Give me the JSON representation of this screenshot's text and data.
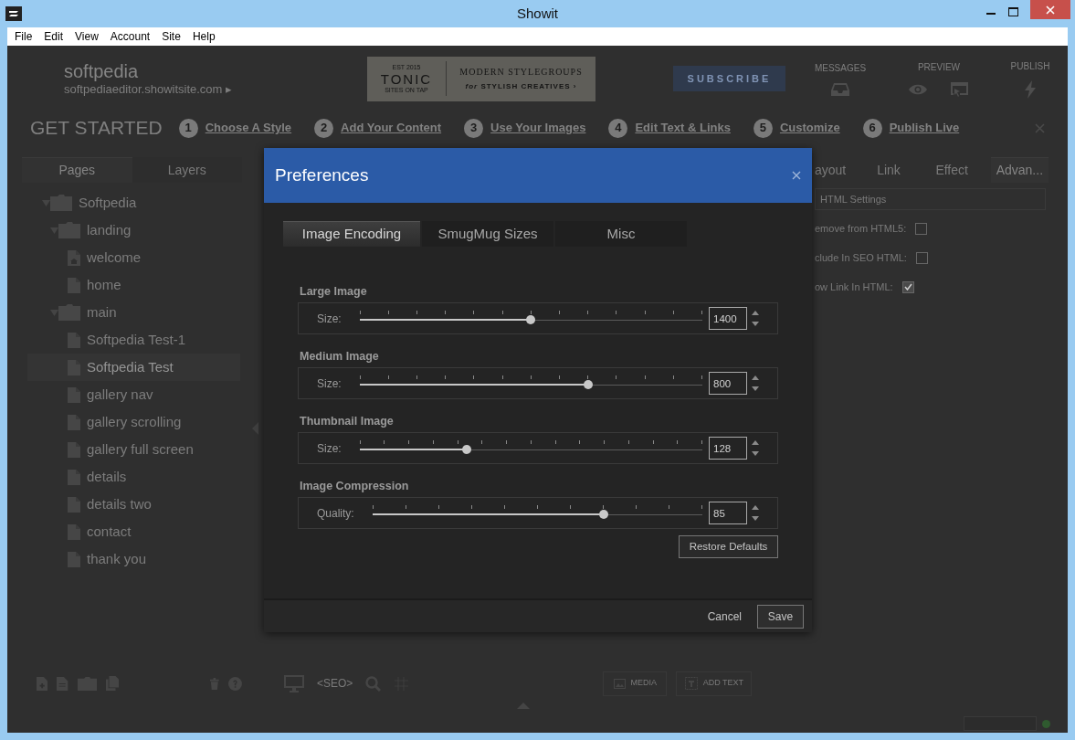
{
  "window": {
    "title": "Showit"
  },
  "menu": [
    {
      "label": "File"
    },
    {
      "label": "Edit"
    },
    {
      "label": "View"
    },
    {
      "label": "Account"
    },
    {
      "label": "Site"
    },
    {
      "label": "Help"
    }
  ],
  "header": {
    "site_name": "softpedia",
    "site_url": "softpediaeditor.showitsite.com ▸",
    "ad": {
      "badge_top": "EST 2015",
      "brand": "TONIC",
      "badge_bottom": "SITES ON TAP",
      "line1": "MODERN STYLEGROUPS",
      "line2": "*for* STYLISH CREATIVES ›"
    },
    "subscribe": "SUBSCRIBE",
    "actions": [
      {
        "label": "MESSAGES",
        "kind": "messages"
      },
      {
        "label": "PREVIEW",
        "kind": "preview"
      },
      {
        "label": "PUBLISH",
        "kind": "publish"
      }
    ]
  },
  "get_started": {
    "title": "GET STARTED",
    "steps": [
      {
        "number": "1",
        "label": "Choose A Style"
      },
      {
        "number": "2",
        "label": "Add Your Content"
      },
      {
        "number": "3",
        "label": "Use Your Images"
      },
      {
        "number": "4",
        "label": "Edit Text & Links"
      },
      {
        "number": "5",
        "label": "Customize"
      },
      {
        "number": "6",
        "label": "Publish Live"
      }
    ]
  },
  "left_panel": {
    "tabs": [
      {
        "label": "Pages",
        "selected": true
      },
      {
        "label": "Layers",
        "selected": false
      }
    ],
    "tree": [
      {
        "label": "Softpedia",
        "kind": "folder",
        "expanded": true,
        "selected": false,
        "children": [
          {
            "label": "landing",
            "kind": "folder",
            "expanded": true,
            "selected": false,
            "children": [
              {
                "label": "welcome",
                "kind": "home",
                "selected": false
              },
              {
                "label": "home",
                "kind": "page",
                "selected": false
              }
            ]
          },
          {
            "label": "main",
            "kind": "folder",
            "expanded": true,
            "selected": false,
            "children": [
              {
                "label": "Softpedia Test-1",
                "kind": "page",
                "selected": false
              },
              {
                "label": "Softpedia Test",
                "kind": "page",
                "selected": true
              },
              {
                "label": "gallery nav",
                "kind": "page",
                "selected": false
              },
              {
                "label": "gallery scrolling",
                "kind": "page",
                "selected": false
              },
              {
                "label": "gallery full screen",
                "kind": "page",
                "selected": false
              },
              {
                "label": "details",
                "kind": "page",
                "selected": false
              },
              {
                "label": "details two",
                "kind": "page",
                "selected": false
              },
              {
                "label": "contact",
                "kind": "page",
                "selected": false
              },
              {
                "label": "thank you",
                "kind": "page",
                "selected": false
              }
            ]
          }
        ]
      }
    ]
  },
  "right_panel": {
    "tabs": [
      {
        "label": "ayout",
        "selected": false
      },
      {
        "label": "Link",
        "selected": false
      },
      {
        "label": "Effect",
        "selected": false
      },
      {
        "label": "Advan...",
        "selected": true
      }
    ],
    "section": "HTML Settings",
    "options": [
      {
        "label": "emove from HTML5:",
        "checked": false
      },
      {
        "label": "clude In SEO HTML:",
        "checked": false
      },
      {
        "label": "ow Link In HTML:",
        "checked": true
      }
    ]
  },
  "bottom_toolbar": {
    "seo": "<SEO>",
    "media": "MEDIA",
    "add_text": "ADD TEXT"
  },
  "dialog": {
    "title": "Preferences",
    "tabs": [
      {
        "label": "Image Encoding",
        "selected": true
      },
      {
        "label": "SmugMug Sizes",
        "selected": false
      },
      {
        "label": "Misc",
        "selected": false
      }
    ],
    "sections": [
      {
        "title": "Large Image",
        "label": "Size:",
        "level": 0.5,
        "value": "1400"
      },
      {
        "title": "Medium Image",
        "label": "Size:",
        "level": 0.666,
        "value": "800"
      },
      {
        "title": "Thumbnail Image",
        "label": "Size:",
        "level": 0.313,
        "value": "128"
      },
      {
        "title": "Image Compression",
        "label": "Quality:",
        "level": 0.7,
        "value": "85"
      }
    ],
    "restore": "Restore Defaults",
    "cancel": "Cancel",
    "save": "Save"
  }
}
